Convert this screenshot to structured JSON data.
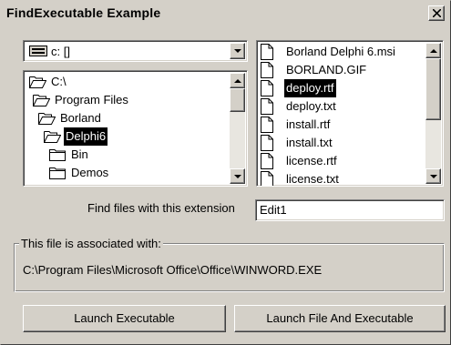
{
  "window": {
    "title": "FindExecutable Example"
  },
  "drive_combo": {
    "value": "c: []"
  },
  "directories": [
    {
      "label": "C:\\",
      "state": "open",
      "selected": false
    },
    {
      "label": "Program Files",
      "state": "open",
      "selected": false
    },
    {
      "label": "Borland",
      "state": "open",
      "selected": false
    },
    {
      "label": "Delphi6",
      "state": "open",
      "selected": true
    },
    {
      "label": "Bin",
      "state": "closed",
      "selected": false
    },
    {
      "label": "Demos",
      "state": "closed",
      "selected": false
    }
  ],
  "files": [
    {
      "name": "Borland Delphi 6.msi",
      "selected": false
    },
    {
      "name": "BORLAND.GIF",
      "selected": false
    },
    {
      "name": "deploy.rtf",
      "selected": true
    },
    {
      "name": "deploy.txt",
      "selected": false
    },
    {
      "name": "install.rtf",
      "selected": false
    },
    {
      "name": "install.txt",
      "selected": false
    },
    {
      "name": "license.rtf",
      "selected": false
    },
    {
      "name": "license.txt",
      "selected": false
    }
  ],
  "extension": {
    "label": "Find files with this extension",
    "value": "Edit1"
  },
  "association": {
    "caption": "This file is associated with:",
    "path": "C:\\Program Files\\Microsoft Office\\Office\\WINWORD.EXE"
  },
  "buttons": {
    "launch": "Launch Executable",
    "launch_both": "Launch File And Executable"
  },
  "colors": {
    "face": "#d4d0c8",
    "selection": "#000000",
    "field": "#ffffff"
  }
}
